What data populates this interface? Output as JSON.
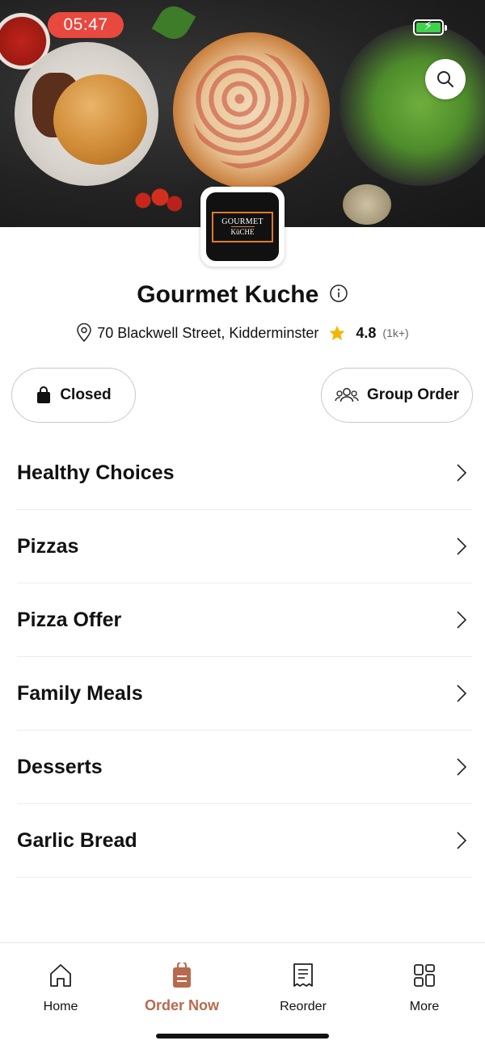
{
  "status_bar": {
    "time": "05:47"
  },
  "restaurant": {
    "logo_line1": "GOURMET",
    "logo_line2": "KüCHE",
    "name": "Gourmet Kuche",
    "address": "70 Blackwell Street, Kidderminster",
    "rating": "4.8",
    "rating_count": "(1k+)"
  },
  "actions": {
    "closed_label": "Closed",
    "group_order_label": "Group Order"
  },
  "menu": {
    "items": [
      {
        "label": "Healthy Choices"
      },
      {
        "label": "Pizzas"
      },
      {
        "label": "Pizza Offer"
      },
      {
        "label": "Family Meals"
      },
      {
        "label": "Desserts"
      },
      {
        "label": "Garlic Bread"
      }
    ]
  },
  "bottom_nav": {
    "items": [
      {
        "label": "Home",
        "icon": "home-icon"
      },
      {
        "label": "Order Now",
        "icon": "order-bag-icon",
        "active": true
      },
      {
        "label": "Reorder",
        "icon": "receipt-icon"
      },
      {
        "label": "More",
        "icon": "grid-icon"
      }
    ]
  },
  "colors": {
    "accent": "#b86a4e",
    "time_pill": "#e9483f",
    "star": "#f2b705",
    "logo_border": "#e07a2e"
  }
}
